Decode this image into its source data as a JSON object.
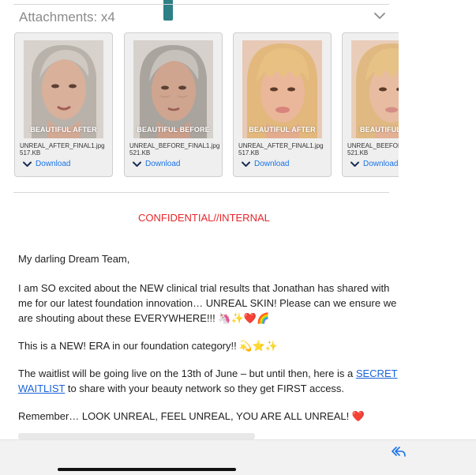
{
  "attachments": {
    "header": "Attachments: x4",
    "items": [
      {
        "caption": "BEAUTIFUL AFTER",
        "file_name": "UNREAL_AFTER_FINAL1.jpg",
        "size": "517.KB",
        "download_label": "Download"
      },
      {
        "caption": "BEAUTIFUL BEFORE",
        "file_name": "UNREAL_BEFORE_FINAL1.jpg",
        "size": "521.KB",
        "download_label": "Download"
      },
      {
        "caption": "BEAUTIFUL AFTER",
        "file_name": "UNREAL_AFTER_FINAL1.jpg",
        "size": "517.KB",
        "download_label": "Download"
      },
      {
        "caption": "BEAUTIFUL B",
        "file_name": "UNREAL_BEEFORE",
        "size": "521.KB",
        "download_label": "Download"
      }
    ]
  },
  "email": {
    "classification": "CONFIDENTIAL//INTERNAL",
    "greeting": "My darling Dream Team,",
    "p1": "I am SO excited about the NEW clinical trial results that Jonathan has shared with me for our latest foundation innovation… UNREAL SKIN! Please can we ensure we are shouting about these EVERYWHERE!!!",
    "p1_emoji": "🦄✨❤️🌈",
    "p2": "This is a NEW! ERA in our foundation category!!",
    "p2_emoji": "💫⭐✨",
    "p3_before": "The waitlist will be going live on the 13th of June – but until then, here is a ",
    "p3_link": "SECRET WAITLIST",
    "p3_after": " to share with your beauty network so they get FIRST access.",
    "p4": "Remember… LOOK UNREAL, FEEL UNREAL, YOU ARE ALL UNREAL!",
    "p4_emoji": "❤️"
  },
  "colors": {
    "link": "#1a63d8",
    "confidential": "#e8262a",
    "accent_tab": "#2e7f86"
  },
  "icons": [
    "chevron-down-icon",
    "download-chevron-icon",
    "reply-all-icon"
  ]
}
